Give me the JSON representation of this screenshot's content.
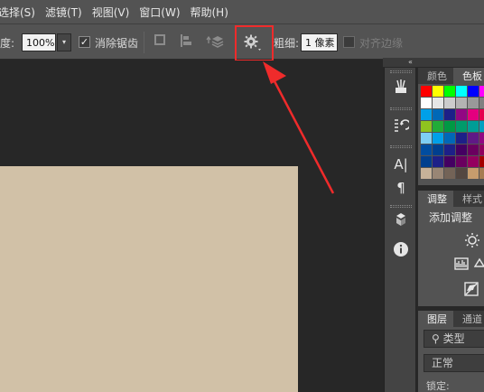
{
  "menu": [
    "选择(S)",
    "滤镜(T)",
    "视图(V)",
    "窗口(W)",
    "帮助(H)"
  ],
  "options": {
    "opacity_label": "度:",
    "opacity_value": "100%",
    "antialias_label": "消除锯齿",
    "antialias_checked": true,
    "weight_label": "粗细:",
    "weight_value": "1 像素",
    "align_edges_label": "对齐边缘",
    "align_edges_checked": false,
    "dropdown_caret": "▾"
  },
  "panel_collapse": "«",
  "color_panel": {
    "tabs": [
      "颜色",
      "色板"
    ],
    "active_tab": 1,
    "swatches": [
      "#ff0000",
      "#ffff00",
      "#00ff00",
      "#00ffff",
      "#0000ff",
      "#ff00ff",
      "#ffffff",
      "#e6e6e6",
      "#cccccc",
      "#b3b3b3",
      "#999999",
      "#808080",
      "#00a0e9",
      "#0068b7",
      "#1d2088",
      "#920783",
      "#e4007f",
      "#e5004f",
      "#8fc31f",
      "#22ac38",
      "#009944",
      "#009b6b",
      "#009e96",
      "#00a0c1",
      "#7ecef4",
      "#00a0e9",
      "#0068b7",
      "#1d2088",
      "#601986",
      "#920783",
      "#004da0",
      "#003f8e",
      "#1d2088",
      "#440062",
      "#6a005f",
      "#8f005f",
      "#003f8e",
      "#1d2088",
      "#440062",
      "#6a005f",
      "#94005f",
      "#a40000",
      "#c7b299",
      "#998675",
      "#736357",
      "#534741",
      "#c69c6d",
      "#a67c52"
    ]
  },
  "adjust_panel": {
    "tabs": [
      "调整",
      "样式"
    ],
    "active_tab": 0,
    "title": "添加调整"
  },
  "layers_panel": {
    "tabs": [
      "图层",
      "通道"
    ],
    "active_tab": 0,
    "filter_label": "类型",
    "blend_mode": "正常",
    "lock_label": "锁定:"
  },
  "colors": {
    "canvas": "#d1c1a7",
    "highlight": "#ef2b2b",
    "ui_bar": "#535353",
    "workspace": "#272727"
  }
}
